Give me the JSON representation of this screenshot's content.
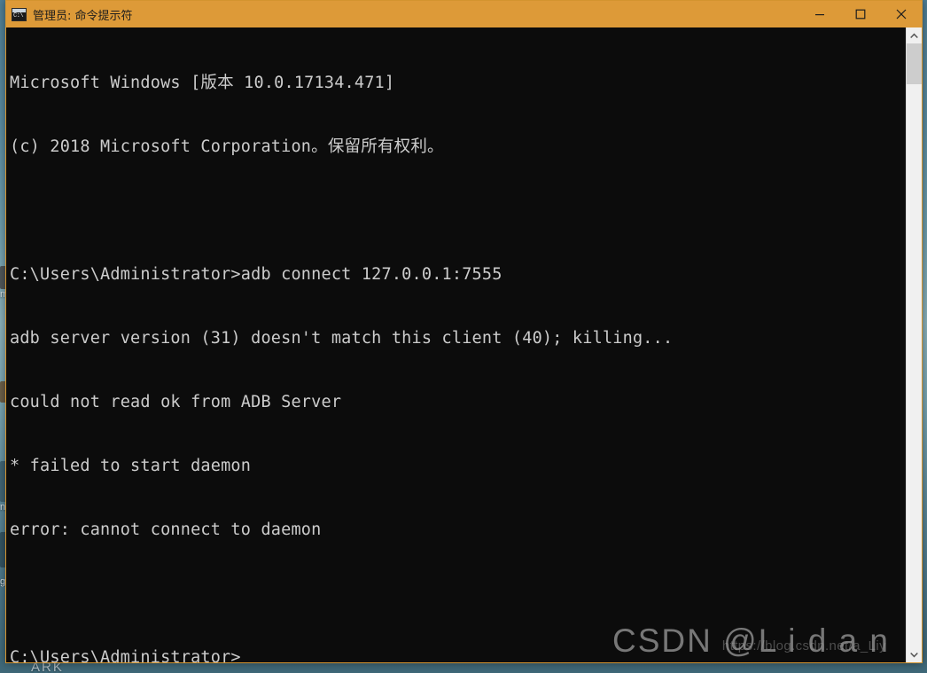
{
  "window": {
    "title": "管理员: 命令提示符",
    "app_icon": "cmd-icon",
    "title_bar_color": "#dd9a38",
    "border_color": "#d4942f",
    "console_bg": "#0c0c0c",
    "console_fg": "#cccccc",
    "controls": {
      "minimize_label": "最小化",
      "maximize_label": "最大化",
      "close_label": "关闭"
    }
  },
  "console": {
    "lines": [
      "Microsoft Windows [版本 10.0.17134.471]",
      "(c) 2018 Microsoft Corporation。保留所有权利。",
      "",
      "C:\\Users\\Administrator>adb connect 127.0.0.1:7555",
      "adb server version (31) doesn't match this client (40); killing...",
      "could not read ok from ADB Server",
      "* failed to start daemon",
      "error: cannot connect to daemon",
      "",
      "C:\\Users\\Administrator>"
    ]
  },
  "scrollbar": {
    "up_arrow": "chevron-up-icon",
    "down_arrow": "chevron-down-icon",
    "thumb_position_percent": 0,
    "thumb_size_percent": 7
  },
  "watermark": {
    "csdn": "CSDN @L i d a n",
    "url": "https://blog.csdn.net/a_Liy"
  },
  "desktop": {
    "icon_label_ark": "ARK",
    "edge_labels": [
      "m",
      "ng",
      "g"
    ]
  }
}
